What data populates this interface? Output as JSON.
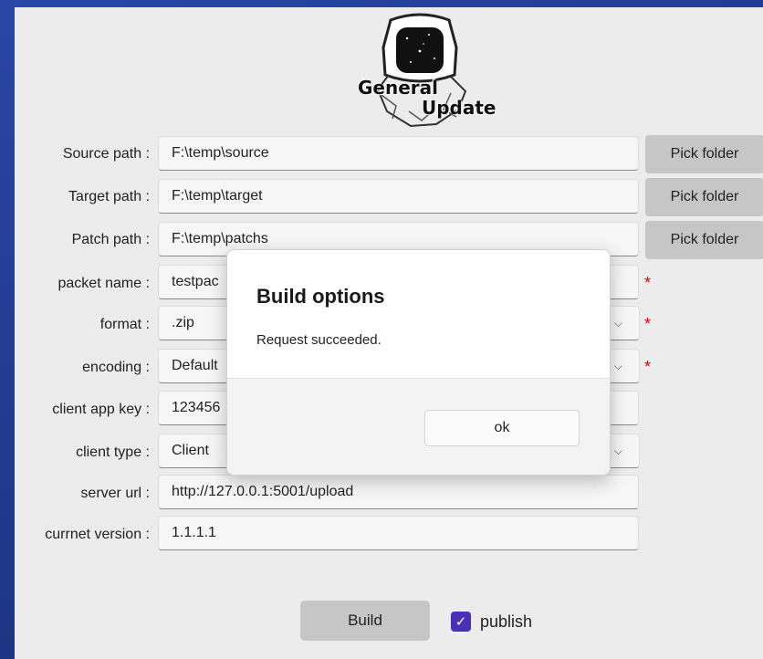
{
  "logo": {
    "line1": "General",
    "line2": "Update"
  },
  "form": {
    "source_path": {
      "label": "Source path :",
      "value": "F:\\temp\\source",
      "button": "Pick folder"
    },
    "target_path": {
      "label": "Target path :",
      "value": "F:\\temp\\target",
      "button": "Pick folder"
    },
    "patch_path": {
      "label": "Patch path :",
      "value": "F:\\temp\\patchs",
      "button": "Pick folder"
    },
    "packet_name": {
      "label": "packet name :",
      "value": "testpac",
      "required": "*"
    },
    "format": {
      "label": "format :",
      "value": ".zip",
      "required": "*"
    },
    "encoding": {
      "label": "encoding :",
      "value": "Default",
      "required": "*"
    },
    "client_app_key": {
      "label": "client app key :",
      "value": "123456"
    },
    "client_type": {
      "label": "client type :",
      "value": "Client"
    },
    "server_url": {
      "label": "server url :",
      "value": "http://127.0.0.1:5001/upload"
    },
    "current_version": {
      "label": "currnet version :",
      "value": "1.1.1.1"
    }
  },
  "actions": {
    "build_label": "Build",
    "publish_label": "publish",
    "publish_checked": true
  },
  "dialog": {
    "title": "Build options",
    "message": "Request succeeded.",
    "ok_label": "ok"
  },
  "colors": {
    "accent": "#4a2fb8",
    "required": "#dd0000",
    "desktop": "#1f3a8a"
  }
}
